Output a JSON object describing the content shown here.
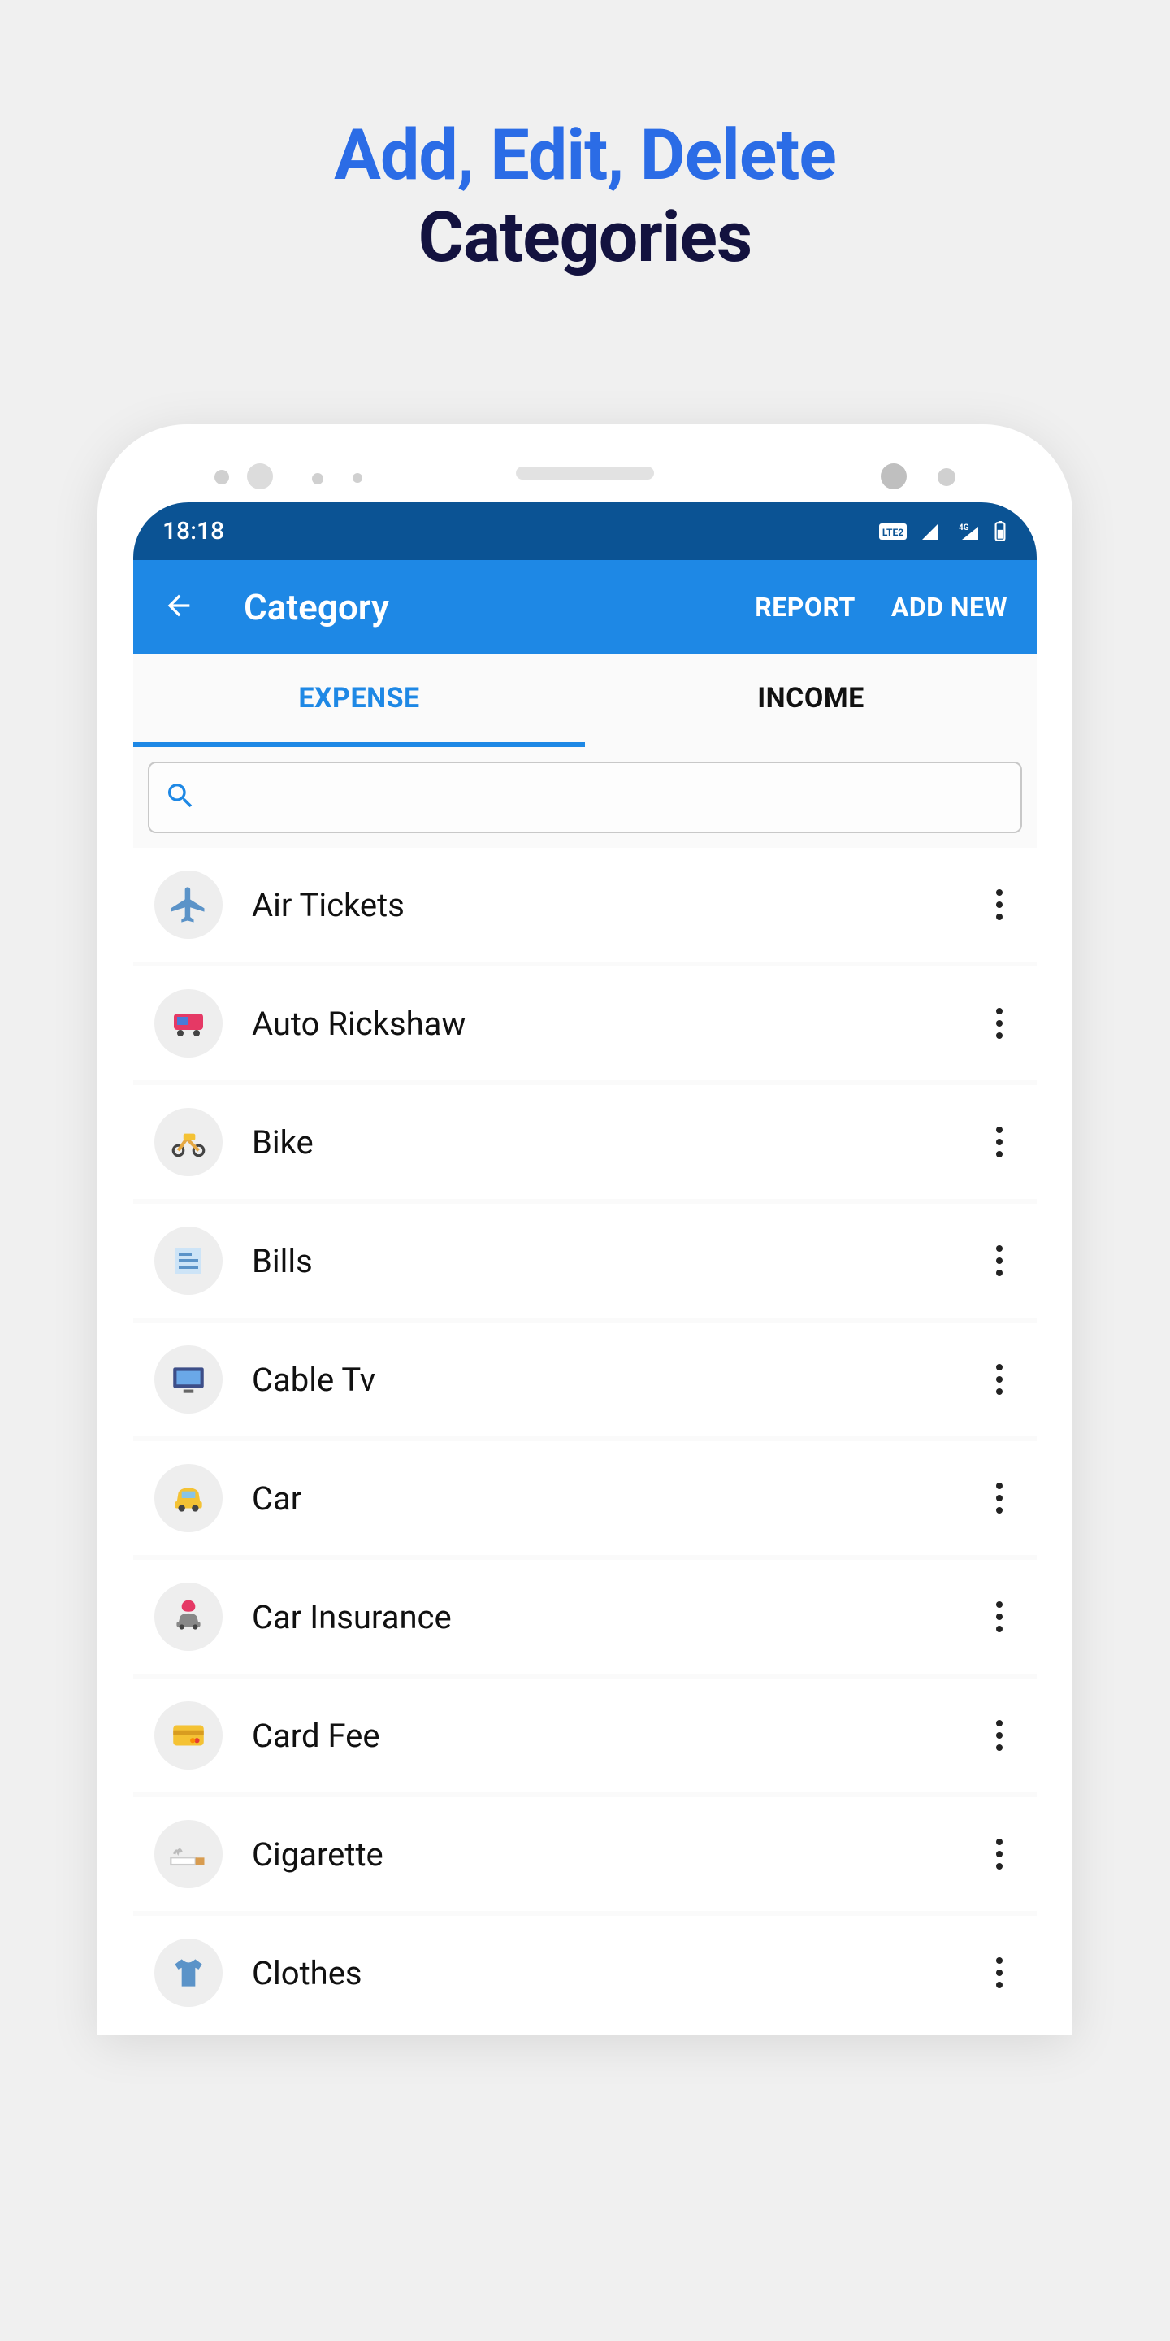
{
  "promo": {
    "line1": "Add, Edit, Delete",
    "line2": "Categories"
  },
  "status": {
    "time": "18:18"
  },
  "appbar": {
    "title": "Category",
    "report_label": "REPORT",
    "addnew_label": "ADD NEW"
  },
  "tabs": {
    "expense": "EXPENSE",
    "income": "INCOME"
  },
  "search": {
    "placeholder": ""
  },
  "categories": [
    {
      "label": "Air Tickets",
      "icon": "airplane-icon",
      "svg": "<svg viewBox='0 0 24 24' width='52' height='52'><path fill='#5B93C8' d='M21 16v-2l-8-5V3.5a1.5 1.5 0 0 0-3 0V9l-8 5v2l8-2.5V19l-2 1.5V22l3.5-1 3.5 1v-1.5L13 19v-5.5l8 2.5z'/></svg>"
    },
    {
      "label": "Auto Rickshaw",
      "icon": "rickshaw-icon",
      "svg": "<svg viewBox='0 0 24 24' width='48' height='48'><rect x='3' y='6' width='18' height='10' rx='2' fill='#E53965'/><rect x='5' y='8' width='7' height='5' fill='#4A7BD8'/><circle cx='7' cy='18' r='2' fill='#444'/><circle cx='17' cy='18' r='2' fill='#444'/></svg>"
    },
    {
      "label": "Bike",
      "icon": "bike-icon",
      "svg": "<svg viewBox='0 0 24 24' width='50' height='50'><circle cx='6' cy='17' r='3' fill='none' stroke='#444' stroke-width='1.5'/><circle cx='18' cy='17' r='3' fill='none' stroke='#444' stroke-width='1.5'/><path d='M6 17 L11 10 L18 17' stroke='#E5A843' stroke-width='2' fill='none'/><rect x='9' y='7' width='7' height='4' rx='1' fill='#F4C234'/></svg>"
    },
    {
      "label": "Bills",
      "icon": "bills-icon",
      "svg": "<svg viewBox='0 0 24 24' width='48' height='48'><rect x='4' y='4' width='16' height='16' fill='#CDE4F7'/><rect x='6' y='7' width='8' height='2' fill='#5B93C8'/><rect x='6' y='11' width='12' height='2' fill='#5B93C8'/><rect x='6' y='15' width='12' height='2' fill='#5B93C8'/></svg>"
    },
    {
      "label": "Cable Tv",
      "icon": "tv-icon",
      "svg": "<svg viewBox='0 0 24 24' width='50' height='50'><rect x='3' y='5' width='18' height='12' rx='1' fill='#3D4E88'/><rect x='5' y='7' width='14' height='8' fill='#6AA8E8'/><rect x='9' y='18' width='6' height='2' fill='#666'/></svg>"
    },
    {
      "label": "Car",
      "icon": "car-icon",
      "svg": "<svg viewBox='0 0 24 24' width='50' height='50'><path d='M5 15 L6 9 Q7 6 12 6 Q17 6 18 9 L19 15 Z' fill='#F4C234'/><rect x='4' y='14' width='16' height='4' rx='1' fill='#F4C234'/><circle cx='8' cy='18' r='2' fill='#444'/><circle cx='16' cy='18' r='2' fill='#444'/><rect x='8' y='8' width='8' height='4' fill='#88C4E8'/></svg>"
    },
    {
      "label": "Car Insurance",
      "icon": "car-insurance-icon",
      "svg": "<svg viewBox='0 0 24 24' width='50' height='50'><path d='M6 16 L7 12 Q8 10 12 10 Q16 10 17 12 L18 16 Z' fill='#888'/><rect x='5' y='15' width='14' height='3' rx='1' fill='#888'/><circle cx='8' cy='18' r='1.5' fill='#444'/><circle cx='16' cy='18' r='1.5' fill='#444'/><path d='M12 2 Q16 3 16 6 Q16 9 12 9 Q8 9 8 6 Q8 3 12 2 Z' fill='#E53965'/></svg>"
    },
    {
      "label": "Card Fee",
      "icon": "card-icon",
      "svg": "<svg viewBox='0 0 24 24' width='50' height='50'><rect x='3' y='6' width='18' height='12' rx='2' fill='#F4C234'/><rect x='3' y='9' width='18' height='3' fill='#D89C20'/><circle cx='17' cy='15' r='1.5' fill='#E53935'/><circle cx='14.5' cy='15' r='1.5' fill='#FB8C00'/></svg>"
    },
    {
      "label": "Cigarette",
      "icon": "cigarette-icon",
      "svg": "<svg viewBox='0 0 24 24' width='52' height='52'><rect x='2' y='14' width='14' height='4' fill='#fff' stroke='#ccc'/><rect x='16' y='14' width='5' height='4' fill='#D89C50'/><path d='M4 12 Q5 9 6 11 Q7 8 8 11' stroke='#bbb' fill='none' stroke-width='1.5'/></svg>"
    },
    {
      "label": "Clothes",
      "icon": "clothes-icon",
      "svg": "<svg viewBox='0 0 24 24' width='50' height='50'><path d='M8 4 L4 7 L6 10 L8 9 L8 20 L16 20 L16 9 L18 10 L20 7 L16 4 Q14 6 12 6 Q10 6 8 4 Z' fill='#5B93C8'/></svg>"
    }
  ]
}
